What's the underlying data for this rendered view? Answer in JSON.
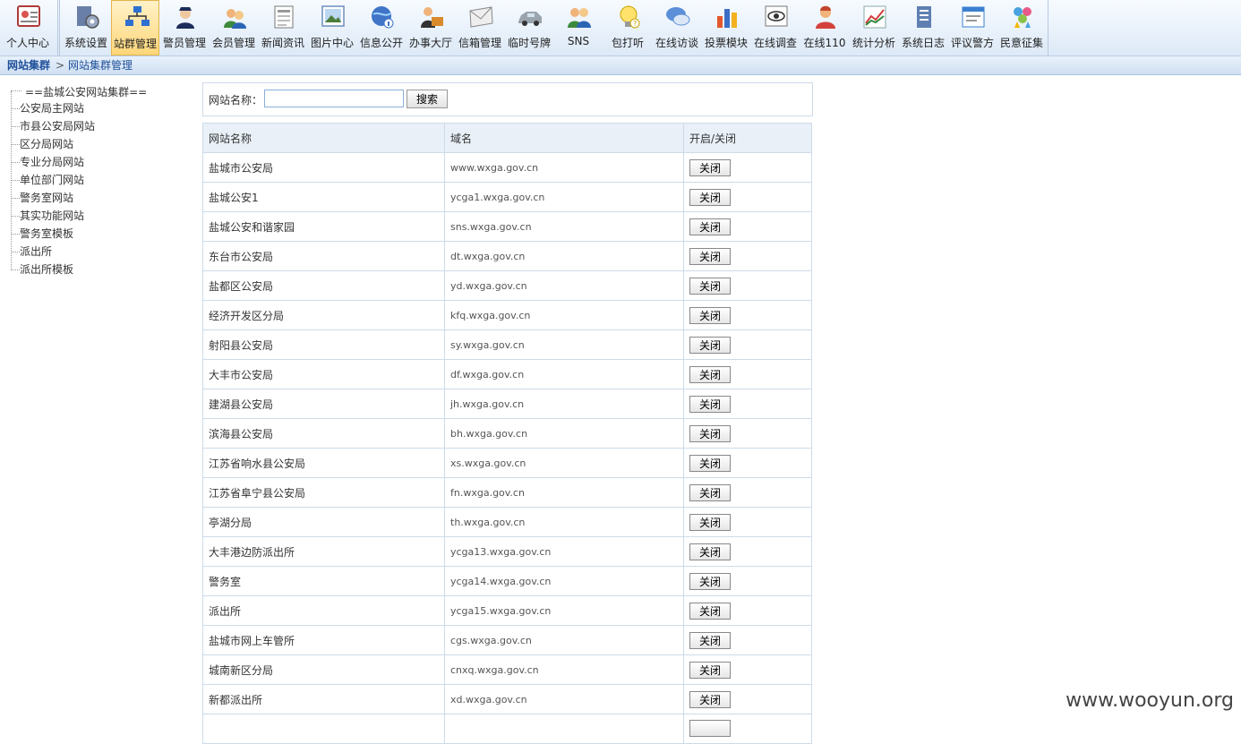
{
  "toolbar": {
    "items": [
      {
        "label": "个人中心",
        "icon": "personal-center-icon"
      },
      {
        "label": "系统设置",
        "icon": "system-settings-icon"
      },
      {
        "label": "站群管理",
        "icon": "site-cluster-icon",
        "active": true
      },
      {
        "label": "警员管理",
        "icon": "police-officer-icon"
      },
      {
        "label": "会员管理",
        "icon": "members-icon"
      },
      {
        "label": "新闻资讯",
        "icon": "news-icon"
      },
      {
        "label": "图片中心",
        "icon": "image-center-icon"
      },
      {
        "label": "信息公开",
        "icon": "info-public-icon"
      },
      {
        "label": "办事大厅",
        "icon": "service-hall-icon"
      },
      {
        "label": "信箱管理",
        "icon": "mailbox-icon"
      },
      {
        "label": "临时号牌",
        "icon": "car-plate-icon"
      },
      {
        "label": "SNS",
        "icon": "sns-icon"
      },
      {
        "label": "包打听",
        "icon": "lightbulb-icon"
      },
      {
        "label": "在线访谈",
        "icon": "chat-icon"
      },
      {
        "label": "投票模块",
        "icon": "vote-chart-icon"
      },
      {
        "label": "在线调查",
        "icon": "survey-eye-icon"
      },
      {
        "label": "在线110",
        "icon": "online-110-icon"
      },
      {
        "label": "统计分析",
        "icon": "statistics-icon"
      },
      {
        "label": "系统日志",
        "icon": "system-log-icon"
      },
      {
        "label": "评议警方",
        "icon": "review-police-icon"
      },
      {
        "label": "民意征集",
        "icon": "opinion-collect-icon"
      }
    ],
    "accent": "#ffd77a"
  },
  "breadcrumb": {
    "root": "网站集群",
    "separator": ">",
    "current": "网站集群管理"
  },
  "tree": {
    "root": "==盐城公安网站集群==",
    "items": [
      "公安局主网站",
      "市县公安局网站",
      "区分局网站",
      "专业分局网站",
      "单位部门网站",
      "警务室网站",
      "其实功能网站",
      "警务室模板",
      "派出所",
      "派出所模板"
    ]
  },
  "search": {
    "label": "网站名称：",
    "value": "",
    "button": "搜索"
  },
  "table": {
    "headers": [
      "网站名称",
      "域名",
      "开启/关闭"
    ],
    "rows": [
      {
        "name": "盐城市公安局",
        "domain": "www.wxga.gov.cn",
        "action": "关闭"
      },
      {
        "name": "盐城公安1",
        "domain": "ycga1.wxga.gov.cn",
        "action": "关闭"
      },
      {
        "name": "盐城公安和谐家园",
        "domain": "sns.wxga.gov.cn",
        "action": "关闭"
      },
      {
        "name": "东台市公安局",
        "domain": "dt.wxga.gov.cn",
        "action": "关闭"
      },
      {
        "name": "盐都区公安局",
        "domain": "yd.wxga.gov.cn",
        "action": "关闭"
      },
      {
        "name": "经济开发区分局",
        "domain": "kfq.wxga.gov.cn",
        "action": "关闭"
      },
      {
        "name": "射阳县公安局",
        "domain": "sy.wxga.gov.cn",
        "action": "关闭"
      },
      {
        "name": "大丰市公安局",
        "domain": "df.wxga.gov.cn",
        "action": "关闭"
      },
      {
        "name": "建湖县公安局",
        "domain": "jh.wxga.gov.cn",
        "action": "关闭"
      },
      {
        "name": "滨海县公安局",
        "domain": "bh.wxga.gov.cn",
        "action": "关闭"
      },
      {
        "name": "江苏省响水县公安局",
        "domain": "xs.wxga.gov.cn",
        "action": "关闭"
      },
      {
        "name": "江苏省阜宁县公安局",
        "domain": "fn.wxga.gov.cn",
        "action": "关闭"
      },
      {
        "name": "亭湖分局",
        "domain": "th.wxga.gov.cn",
        "action": "关闭"
      },
      {
        "name": "大丰港边防派出所",
        "domain": "ycga13.wxga.gov.cn",
        "action": "关闭"
      },
      {
        "name": "警务室",
        "domain": "ycga14.wxga.gov.cn",
        "action": "关闭"
      },
      {
        "name": "派出所",
        "domain": "ycga15.wxga.gov.cn",
        "action": "关闭"
      },
      {
        "name": "盐城市网上车管所",
        "domain": "cgs.wxga.gov.cn",
        "action": "关闭"
      },
      {
        "name": "城南新区分局",
        "domain": "cnxq.wxga.gov.cn",
        "action": "关闭"
      },
      {
        "name": "新都派出所",
        "domain": "xd.wxga.gov.cn",
        "action": "关闭"
      },
      {
        "name": "",
        "domain": "",
        "action": ""
      }
    ]
  },
  "watermark": "www.wooyun.org"
}
